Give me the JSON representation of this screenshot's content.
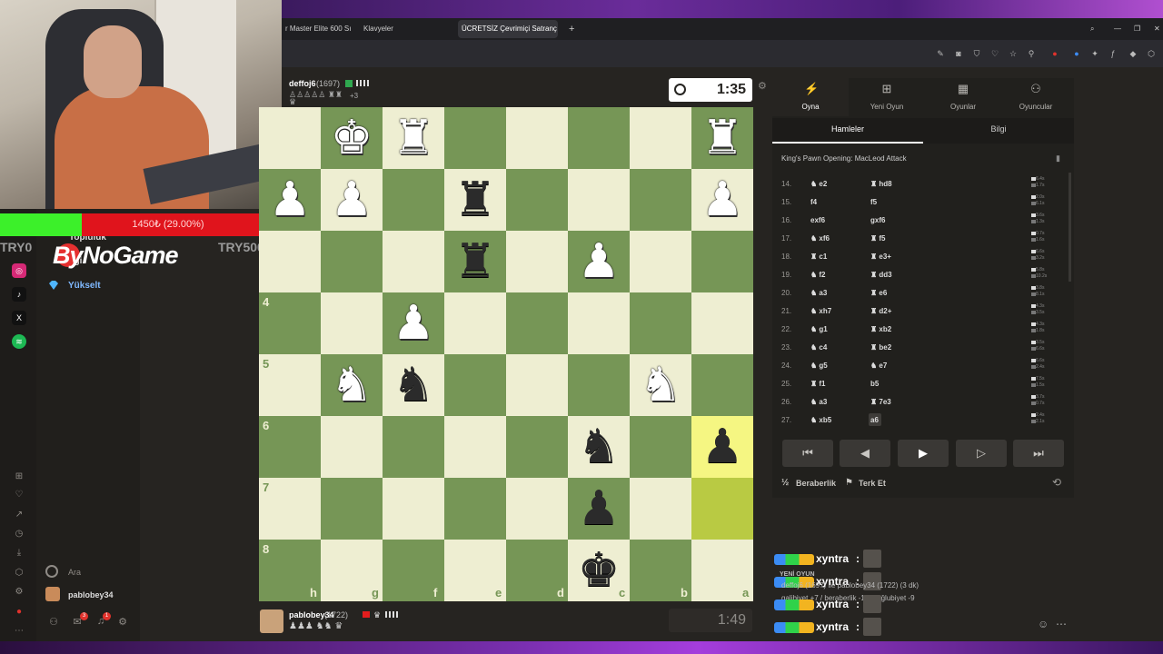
{
  "browser": {
    "tabs": [
      {
        "label": "r Master Elite 600 Sı"
      },
      {
        "label": "Klavyeler"
      },
      {
        "label": "ÜCRETSİZ Çevrimiçi Satranç"
      }
    ],
    "new_tab": "+",
    "window_buttons": {
      "minimize": "—",
      "restore": "❐",
      "close": "✕"
    }
  },
  "stream": {
    "donation": {
      "text": "1450₺ (29.00%)",
      "left_label": "TRY0",
      "right_label": "TRY5000",
      "brand": "ByNoGame"
    },
    "colors": {
      "progress": "#3cf02a",
      "remaining": "#e0141c"
    }
  },
  "sidebar": {
    "items": [
      {
        "label": "Topluluk"
      },
      {
        "label": "İlgi"
      },
      {
        "label": "Yükselt"
      }
    ],
    "search_label": "Ara",
    "username": "pablobey34",
    "mail_badge": "3",
    "bell_badge": "1"
  },
  "game": {
    "opponent": {
      "name": "deffoj6",
      "rating": "(1697)",
      "captured_extra": "+3",
      "clock": "1:35"
    },
    "player": {
      "name": "pablobey34",
      "rating": "(1722)",
      "clock": "1:49"
    },
    "files": [
      "h",
      "g",
      "f",
      "e",
      "d",
      "c",
      "b",
      "a"
    ],
    "ranks": [
      "4",
      "5",
      "6",
      "7",
      "8"
    ],
    "pieces": [
      {
        "square": "g1",
        "glyph": "♚",
        "color": "white"
      },
      {
        "square": "f1",
        "glyph": "♜",
        "color": "white"
      },
      {
        "square": "a1",
        "glyph": "♜",
        "color": "white"
      },
      {
        "square": "h2",
        "glyph": "♟",
        "color": "white"
      },
      {
        "square": "g2",
        "glyph": "♟",
        "color": "white"
      },
      {
        "square": "e2",
        "glyph": "♜",
        "color": "black"
      },
      {
        "square": "a2",
        "glyph": "♟",
        "color": "white"
      },
      {
        "square": "e3",
        "glyph": "♜",
        "color": "black"
      },
      {
        "square": "c3",
        "glyph": "♟",
        "color": "white"
      },
      {
        "square": "f4",
        "glyph": "♟",
        "color": "white"
      },
      {
        "square": "g5",
        "glyph": "♞",
        "color": "white"
      },
      {
        "square": "f5",
        "glyph": "♞",
        "color": "black"
      },
      {
        "square": "b5",
        "glyph": "♞",
        "color": "white"
      },
      {
        "square": "c6",
        "glyph": "♞",
        "color": "black"
      },
      {
        "square": "a6",
        "glyph": "♟",
        "color": "black"
      },
      {
        "square": "c7",
        "glyph": "♟",
        "color": "black"
      },
      {
        "square": "c8",
        "glyph": "♚",
        "color": "black"
      }
    ],
    "highlight_squares": [
      "a6",
      "a7"
    ]
  },
  "panel": {
    "nav": [
      {
        "label": "Oyna",
        "icon": "lightning-icon"
      },
      {
        "label": "Yeni Oyun",
        "icon": "plus-square-icon"
      },
      {
        "label": "Oyunlar",
        "icon": "board-icon"
      },
      {
        "label": "Oyuncular",
        "icon": "users-icon"
      }
    ],
    "subtabs": {
      "moves": "Hamleler",
      "info": "Bilgi"
    },
    "opening": "King's Pawn Opening: MacLeod Attack",
    "moves": [
      {
        "n": "14.",
        "w": "e2",
        "wp": "♞",
        "b": "hd8",
        "bp": "♜",
        "wt": "6.4s",
        "bt": "1.7s"
      },
      {
        "n": "15.",
        "w": "f4",
        "wp": "",
        "b": "f5",
        "bp": "",
        "wt": "2.0s",
        "bt": "6.1s"
      },
      {
        "n": "16.",
        "w": "exf6",
        "wp": "",
        "b": "gxf6",
        "bp": "",
        "wt": "3.6s",
        "bt": "1.3s"
      },
      {
        "n": "17.",
        "w": "xf6",
        "wp": "♞",
        "b": "f5",
        "bp": "♜",
        "wt": "0.7s",
        "bt": "1.6s"
      },
      {
        "n": "18.",
        "w": "c1",
        "wp": "♜",
        "b": "e3+",
        "bp": "♜",
        "wt": "6.6s",
        "bt": "3.2s"
      },
      {
        "n": "19.",
        "w": "f2",
        "wp": "♞",
        "b": "dd3",
        "bp": "♜",
        "wt": "5.8s",
        "bt": "10.2s"
      },
      {
        "n": "20.",
        "w": "a3",
        "wp": "♞",
        "b": "e6",
        "bp": "♜",
        "wt": "3.8s",
        "bt": "8.1s"
      },
      {
        "n": "21.",
        "w": "xh7",
        "wp": "♞",
        "b": "d2+",
        "bp": "♜",
        "wt": "4.3s",
        "bt": "3.5s"
      },
      {
        "n": "22.",
        "w": "g1",
        "wp": "♞",
        "b": "xb2",
        "bp": "♜",
        "wt": "4.3s",
        "bt": "1.8s"
      },
      {
        "n": "23.",
        "w": "c4",
        "wp": "♞",
        "b": "be2",
        "bp": "♜",
        "wt": "3.5s",
        "bt": "6.6s"
      },
      {
        "n": "24.",
        "w": "g5",
        "wp": "♞",
        "b": "e7",
        "bp": "♞",
        "wt": "6.6s",
        "bt": "2.4s"
      },
      {
        "n": "25.",
        "w": "f1",
        "wp": "♜",
        "b": "b5",
        "bp": "",
        "wt": "7.5s",
        "bt": "1.5s"
      },
      {
        "n": "26.",
        "w": "a3",
        "wp": "♞",
        "b": "7e3",
        "bp": "♜",
        "wt": "3.7s",
        "bt": "0.7s"
      },
      {
        "n": "27.",
        "w": "xb5",
        "wp": "♞",
        "b": "a6",
        "bp": "",
        "wt": "2.4s",
        "bt": "2.1s"
      }
    ],
    "controls": [
      "⏮",
      "◀",
      "▶",
      "▷",
      "⏭"
    ],
    "draw_label": "Beraberlik",
    "resign_label": "Terk Et"
  },
  "chat": {
    "rows": [
      {
        "user": "xyntra",
        "colon": ":"
      },
      {
        "user": "xyntra",
        "colon": ":"
      },
      {
        "user": "xyntra",
        "colon": ":"
      },
      {
        "user": "xyntra",
        "colon": ":"
      }
    ],
    "new_game": "YENİ OYUN",
    "note1": "deffoj6 (1697) ile pablobey34 (1722) (3 dk)",
    "note2": "galibiyet +7 / beraberlik -1 / mağlubiyet -9"
  }
}
